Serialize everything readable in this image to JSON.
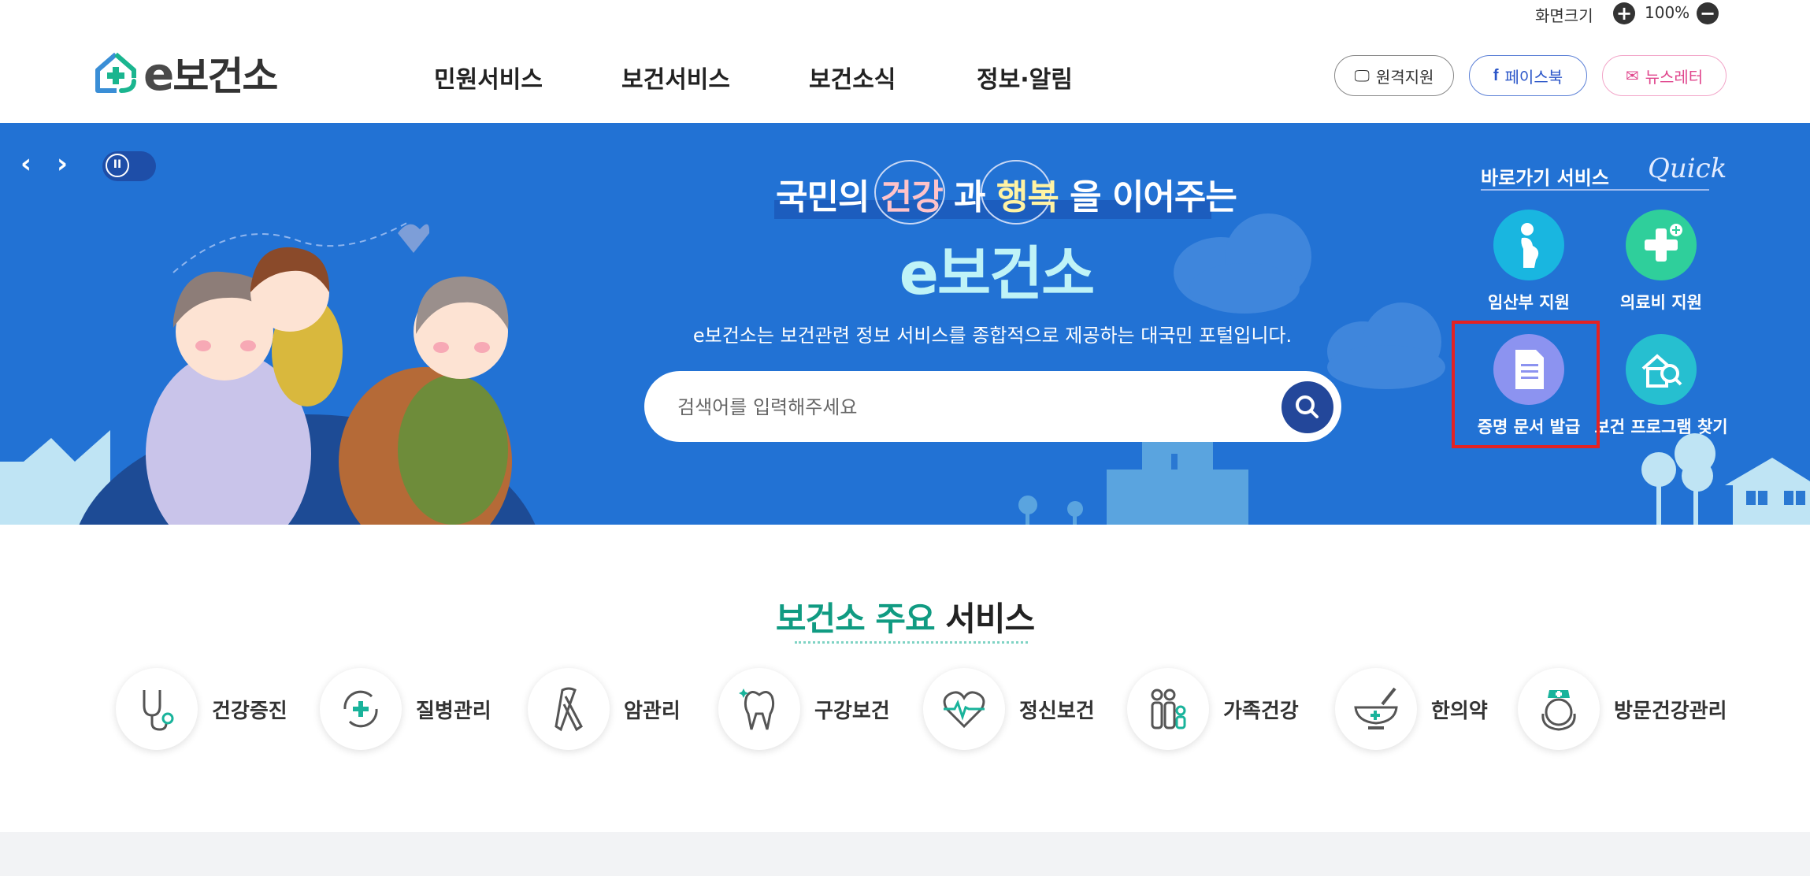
{
  "utility": {
    "zoom_label": "화면크기",
    "zoom_value": "100%",
    "zoom_in_icon": "plus-icon",
    "zoom_out_icon": "minus-icon"
  },
  "logo": {
    "text_e": "e",
    "text_rest": "보건소"
  },
  "gnb": [
    "민원서비스",
    "보건서비스",
    "보건소식",
    "정보·알림"
  ],
  "header_buttons": {
    "remote": "원격지원",
    "facebook": "페이스북",
    "newsletter": "뉴스레터"
  },
  "hero": {
    "tagline_1": "국민의 ",
    "tagline_hl1": "건강",
    "tagline_2": " 과 ",
    "tagline_hl2": "행복",
    "tagline_3": " 을 이어주는",
    "brand": "e보건소",
    "description": "e보건소는 보건관련 정보 서비스를 종합적으로 제공하는 대국민 포털입니다.",
    "search_placeholder": "검색어를 입력해주세요"
  },
  "quick": {
    "title": "바로가기 서비스",
    "subtitle": "Quick",
    "items": [
      {
        "label": "임산부 지원",
        "color": "#19b6e0"
      },
      {
        "label": "의료비 지원",
        "color": "#2fcf9b"
      },
      {
        "label": "증명 문서 발급",
        "color": "#8c93f0"
      },
      {
        "label": "보건 프로그램 찾기",
        "color": "#26bfd0"
      }
    ]
  },
  "services": {
    "title_green": "보건소 주요",
    "title_dark": " 서비스",
    "items": [
      {
        "label": "건강증진",
        "icon": "stethoscope-icon"
      },
      {
        "label": "질병관리",
        "icon": "disease-cycle-icon"
      },
      {
        "label": "암관리",
        "icon": "ribbon-icon"
      },
      {
        "label": "구강보건",
        "icon": "tooth-icon"
      },
      {
        "label": "정신보건",
        "icon": "heart-pulse-icon"
      },
      {
        "label": "가족건강",
        "icon": "family-icon"
      },
      {
        "label": "한의약",
        "icon": "mortar-icon"
      },
      {
        "label": "방문건강관리",
        "icon": "nurse-icon"
      }
    ]
  },
  "colors": {
    "hero_bg": "#2272d4",
    "accent_green": "#109b82",
    "highlight_red": "#e32222"
  }
}
